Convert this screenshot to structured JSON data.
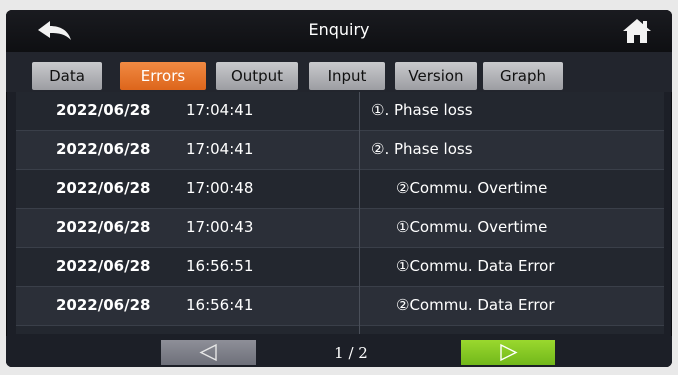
{
  "header": {
    "title": "Enquiry",
    "back_icon": "back-arrow-icon",
    "home_icon": "home-icon"
  },
  "tabs": [
    {
      "label": "Data",
      "active": false
    },
    {
      "label": "Errors",
      "active": true
    },
    {
      "label": "Output",
      "active": false
    },
    {
      "label": "Input",
      "active": false
    },
    {
      "label": "Version",
      "active": false
    },
    {
      "label": "Graph",
      "active": false
    }
  ],
  "errors": [
    {
      "date": "2022/06/28",
      "time": "17:04:41",
      "message": "①. Phase loss"
    },
    {
      "date": "2022/06/28",
      "time": "17:04:41",
      "message": "②. Phase loss"
    },
    {
      "date": "2022/06/28",
      "time": "17:00:48",
      "message": "②Commu. Overtime"
    },
    {
      "date": "2022/06/28",
      "time": "17:00:43",
      "message": "①Commu. Overtime"
    },
    {
      "date": "2022/06/28",
      "time": "16:56:51",
      "message": "①Commu. Data Error"
    },
    {
      "date": "2022/06/28",
      "time": "16:56:41",
      "message": "②Commu. Data Error"
    }
  ],
  "pager": {
    "label": "1 / 2",
    "prev_icon": "triangle-left-icon",
    "next_icon": "triangle-right-icon"
  },
  "colors": {
    "active_tab": "#e8722a",
    "next_button": "#84c824",
    "prev_button": "#7d7f88"
  }
}
